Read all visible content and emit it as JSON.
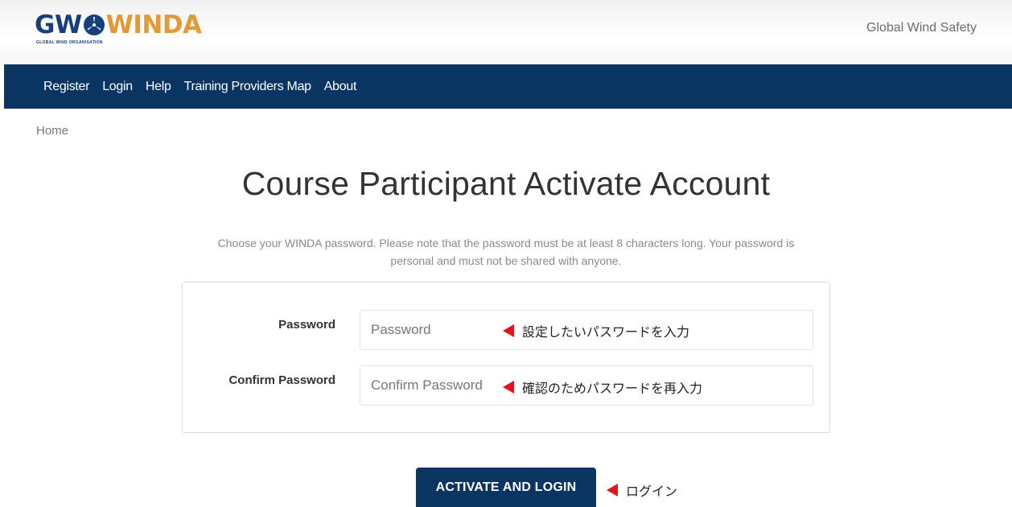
{
  "header": {
    "logo": {
      "left": "GW",
      "right": "WINDA",
      "tagline": "GLOBAL WIND ORGANISATION"
    },
    "brand_right": "Global Wind Safety"
  },
  "nav": {
    "items": [
      {
        "label": "Register"
      },
      {
        "label": "Login"
      },
      {
        "label": "Help"
      },
      {
        "label": "Training Providers Map"
      },
      {
        "label": "About"
      }
    ]
  },
  "breadcrumb": {
    "home": "Home"
  },
  "page": {
    "title": "Course Participant Activate Account",
    "intro_line1": "Choose your WINDA password. Please note that the password must be at least 8 characters long. Your password is",
    "intro_line2": "personal and must not be shared with anyone."
  },
  "form": {
    "password": {
      "label": "Password",
      "placeholder": "Password",
      "value": ""
    },
    "confirm_password": {
      "label": "Confirm Password",
      "placeholder": "Confirm Password",
      "value": ""
    },
    "submit_label": "ACTIVATE AND LOGIN"
  },
  "annotations": {
    "password": "設定したいパスワードを入力",
    "confirm_password": "確認のためパスワードを再入力",
    "submit": "ログイン"
  },
  "colors": {
    "navy": "#0a3563",
    "logo_blue": "#173f7a",
    "logo_orange": "#e39a36",
    "annotation_red": "#e3141b"
  }
}
